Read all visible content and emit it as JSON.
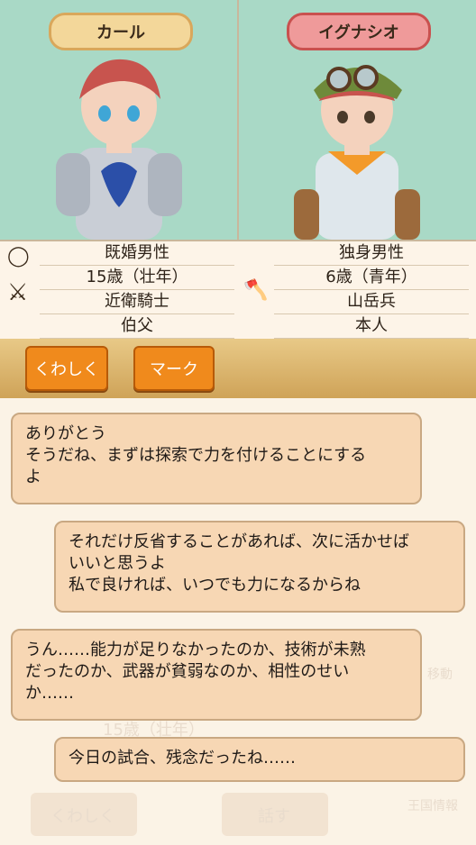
{
  "characters": {
    "left": {
      "name": "カール",
      "status": "既婚男性",
      "age": "15歳（壮年）",
      "job": "近衛騎士",
      "relation": "伯父",
      "icons": [
        "ring-icon",
        "crossed-swords-icon"
      ]
    },
    "right": {
      "name": "イグナシオ",
      "status": "独身男性",
      "age": "6歳（青年）",
      "job": "山岳兵",
      "relation": "本人",
      "icons": [
        "axe-icon"
      ]
    }
  },
  "buttons": {
    "details": "くわしく",
    "mark": "マーク"
  },
  "background_ghost": {
    "age_text": "15歳（壮年）",
    "details": "くわしく",
    "talk": "話す",
    "move": "移動",
    "kingdom": "王国情報"
  },
  "messages": [
    {
      "side": "left",
      "text": "ありがとう\nそうだね、まずは探索で力を付けることにする\nよ"
    },
    {
      "side": "right",
      "text": "それだけ反省することがあれば、次に活かせば\nいいと思うよ\n私で良ければ、いつでも力になるからね"
    },
    {
      "side": "left",
      "text": "うん……能力が足りなかったのか、技術が未熟\nだったのか、武器が貧弱なのか、相性のせい\nか……"
    },
    {
      "side": "right",
      "text": "今日の試合、残念だったね……"
    }
  ],
  "colors": {
    "top_bg": "#a9d9c6",
    "left_name_bg": "#f3d79a",
    "right_name_bg": "#ef9a9a",
    "button_orange": "#f08a1c",
    "bubble": "#f7d7b4"
  }
}
